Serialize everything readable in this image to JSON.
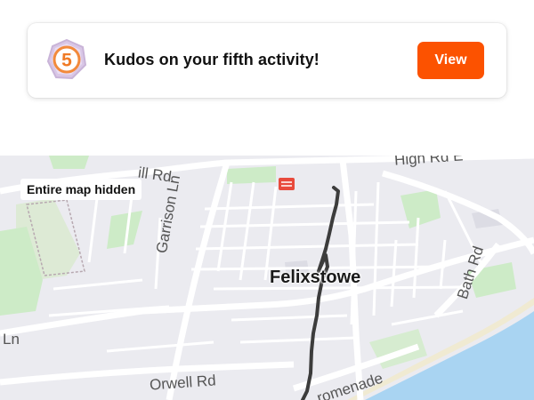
{
  "notification": {
    "badge_number": "5",
    "message": "Kudos on your fifth activity!",
    "button_label": "View",
    "accent_color": "#fc5200"
  },
  "map": {
    "status_label": "Entire map hidden",
    "town_label": "Felixstowe",
    "roads": [
      {
        "id": "high-rd",
        "label": "High Rd E"
      },
      {
        "id": "hill-rd",
        "label": "ill Rd"
      },
      {
        "id": "garrison-ln",
        "label": "Garrison Ln"
      },
      {
        "id": "bath-rd",
        "label": "Bath Rd"
      },
      {
        "id": "ln",
        "label": "Ln"
      },
      {
        "id": "orwell-rd",
        "label": "Orwell Rd"
      },
      {
        "id": "promenade",
        "label": "romenade"
      }
    ],
    "colors": {
      "land": "#ebebf0",
      "park": "#cdebc7",
      "sea": "#a9d4f2",
      "route": "#3c3c3c"
    }
  }
}
